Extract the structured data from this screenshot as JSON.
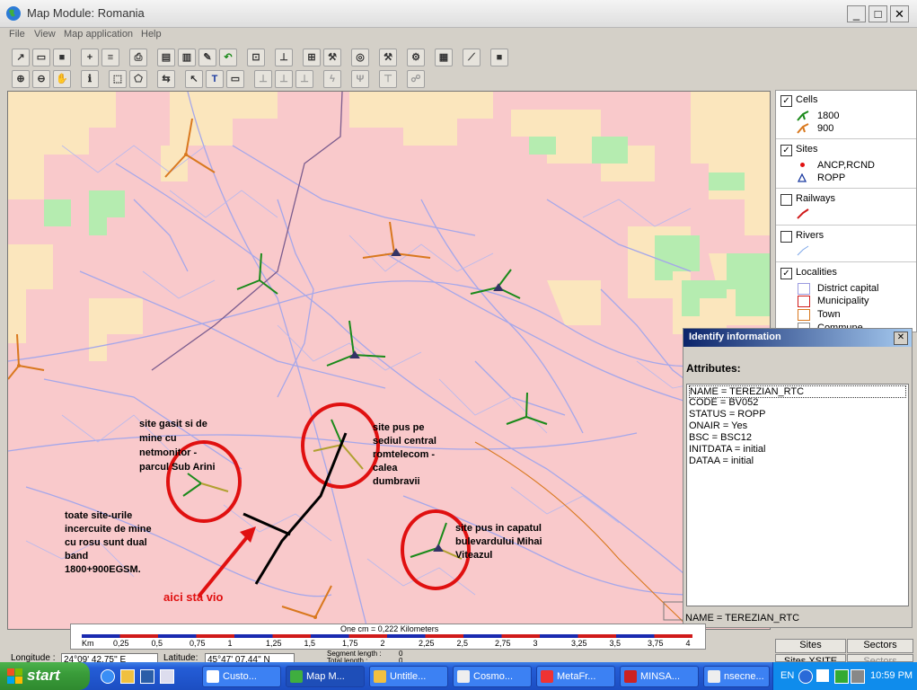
{
  "window": {
    "title": "Map Module: Romania",
    "min": "_",
    "max": "□",
    "close": "✕"
  },
  "menu": [
    "File",
    "View",
    "Map application",
    "Help"
  ],
  "legend": {
    "cells": {
      "label": "Cells",
      "checked": true,
      "items": [
        "1800",
        "900"
      ]
    },
    "sites": {
      "label": "Sites",
      "checked": true,
      "items": [
        "ANCP,RCND",
        "ROPP"
      ]
    },
    "railways": {
      "label": "Railways",
      "checked": false
    },
    "rivers": {
      "label": "Rivers",
      "checked": false
    },
    "localities": {
      "label": "Localities",
      "checked": true,
      "items": [
        "District capital",
        "Municipality",
        "Town",
        "Commune"
      ]
    }
  },
  "identify": {
    "title": "Identify information",
    "close": "✕",
    "attributes_label": "Attributes:",
    "rows": [
      "NAME = TEREZIAN_RTC",
      "CODE = BV052",
      "STATUS = ROPP",
      "ONAIR = Yes",
      "BSC = BSC12",
      "INITDATA = initial",
      "DATAA = initial"
    ],
    "status": "NAME = TEREZIAN_RTC"
  },
  "annotations": {
    "site_netmonitor": [
      "site gasit si de",
      "mine cu",
      "netmonitor -",
      "parcul Sub Arini"
    ],
    "site_romtelecom": [
      "site pus pe",
      "sediul central",
      "romtelecom -",
      "calea",
      "dumbravii"
    ],
    "site_bulevard": [
      "site pus in capatul",
      "bulevardului Mihai",
      "Viteazul"
    ],
    "dual_band": [
      "toate site-urile",
      "incercuite de mine",
      "cu rosu sunt dual",
      "band",
      "1800+900EGSM."
    ],
    "vio": "aici sta vio"
  },
  "scale": {
    "title": "One cm = 0,222 Kilometers",
    "unit": "Km",
    "ticks": [
      "0,25",
      "0,5",
      "0,75",
      "1",
      "1,25",
      "1,5",
      "1,75",
      "2",
      "2,25",
      "2,5",
      "2,75",
      "3",
      "3,25",
      "3,5",
      "3,75",
      "4"
    ]
  },
  "status": {
    "longitude_label": "Longitude :",
    "longitude": "24°09' 42.75'' E",
    "latitude_label": "Latitude:",
    "latitude": "45°47' 07.44'' N",
    "segment_label": "Segment length :",
    "segment": "0",
    "total_label": "Total length :",
    "total": "0"
  },
  "tabs": {
    "sites": "Sites",
    "sectors": "Sectors",
    "sites_xsite": "Sites XSITE",
    "sectors2": "Sectors"
  },
  "taskbar": {
    "start": "start",
    "tasks": [
      "Custo...",
      "Map M...",
      "Untitle...",
      "Cosmo...",
      "MetaFr...",
      "MINSA...",
      "nsecne..."
    ],
    "lang": "EN",
    "clock": "10:59 PM"
  },
  "colors": {
    "band_1800": "#1a8a1a",
    "band_900": "#d9781e",
    "circle": "#e01010",
    "vio_text": "#e01010"
  }
}
